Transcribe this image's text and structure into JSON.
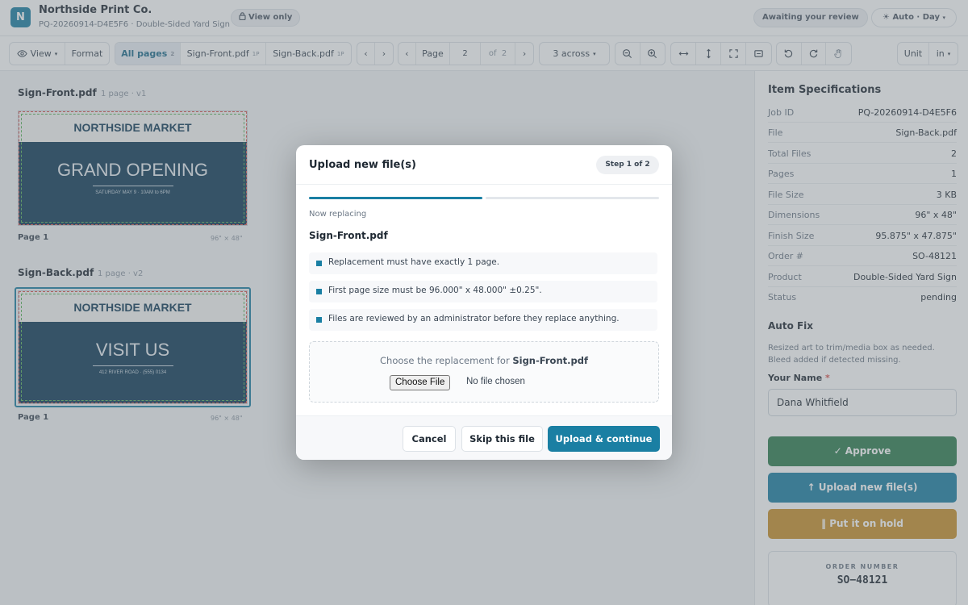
{
  "header": {
    "logo_letter": "N",
    "company": "Northside Print Co.",
    "job_subtitle": "PQ-20260914-D4E5F6 · Double-Sided Yard Sign",
    "view_only": "View only",
    "status_pill": "Awaiting your review",
    "theme": "☀ Auto · Day"
  },
  "toolbar": {
    "view": "View",
    "format": "Format",
    "all_pages": "All pages",
    "all_pages_count": "2",
    "file1": "Sign-Front.pdf",
    "file1_pages": "1P",
    "file2": "Sign-Back.pdf",
    "file2_pages": "1P",
    "prev": "‹",
    "next": "›",
    "page_label": "Page",
    "page_current": "2",
    "page_of": "of",
    "page_total": "2",
    "layout": "3 across",
    "unit_label": "Unit",
    "unit_value": "in"
  },
  "files": [
    {
      "name": "Sign-Front.pdf",
      "meta": "1 page · v1",
      "band": "NORTHSIDE MARKET",
      "headline": "GRAND OPENING",
      "detail": "SATURDAY MAY 9  ·  10AM to 6PM",
      "page_label": "Page 1",
      "size": "96\" × 48\""
    },
    {
      "name": "Sign-Back.pdf",
      "meta": "1 page · v2",
      "band": "NORTHSIDE MARKET",
      "headline": "VISIT US",
      "detail": "412 RIVER ROAD  ·  (555) 0134",
      "page_label": "Page 1",
      "size": "96\" × 48\""
    }
  ],
  "specs": {
    "title": "Item Specifications",
    "rows": [
      {
        "k": "Job ID",
        "v": "PQ-20260914-D4E5F6"
      },
      {
        "k": "File",
        "v": "Sign-Back.pdf"
      },
      {
        "k": "Total Files",
        "v": "2"
      },
      {
        "k": "Pages",
        "v": "1"
      },
      {
        "k": "File Size",
        "v": "3 KB"
      },
      {
        "k": "Dimensions",
        "v": "96\" x 48\""
      },
      {
        "k": "Finish Size",
        "v": "95.875\" x 47.875\""
      },
      {
        "k": "Order #",
        "v": "SO-48121"
      },
      {
        "k": "Product",
        "v": "Double-Sided Yard Sign"
      },
      {
        "k": "Status",
        "v": "pending"
      }
    ],
    "autofix_title": "Auto Fix",
    "autofix_text": "Resized art to trim/media box as needed. Bleed added if detected missing.",
    "name_label": "Your Name",
    "name_required": "*",
    "name_value": "Dana Whitfield",
    "approve": "✓ Approve",
    "upload": "↑ Upload new file(s)",
    "hold": "‖ Put it on hold",
    "order_label": "ORDER NUMBER",
    "order_number": "SO−48121"
  },
  "colors": {
    "accent": "#1a7fa3",
    "approve": "#2e7d4f",
    "upload": "#1a7fa3",
    "hold": "#c8902a",
    "sign_bg": "#0e3a57"
  },
  "modal": {
    "title": "Upload new file(s)",
    "step": "Step 1 of 2",
    "progress": 0.5,
    "now_replacing": "Now replacing",
    "file": "Sign-Front.pdf",
    "rules": [
      "Replacement must have exactly 1 page.",
      "First page size must be 96.000\" x 48.000\" ±0.25\".",
      "Files are reviewed by an administrator before they replace anything."
    ],
    "choose_prefix": "Choose the replacement for",
    "choose_file": "Sign-Front.pdf",
    "choose_button": "Choose File",
    "no_file": "No file chosen",
    "cancel": "Cancel",
    "skip": "Skip this file",
    "continue": "Upload & continue"
  }
}
